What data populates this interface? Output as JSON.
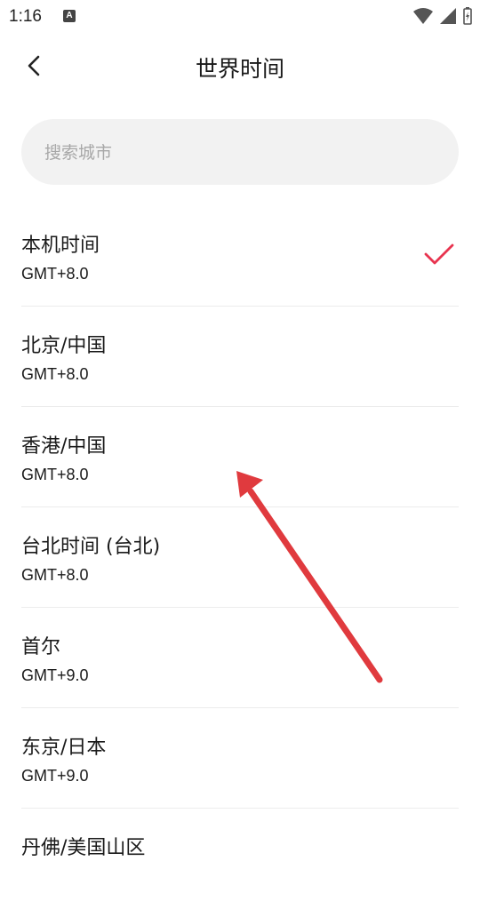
{
  "status_bar": {
    "time": "1:16",
    "notification_letter": "A"
  },
  "header": {
    "title": "世界时间",
    "back_icon": "chevron-left-icon"
  },
  "search": {
    "placeholder": "搜索城市",
    "value": ""
  },
  "cities": [
    {
      "name": "本机时间",
      "offset": "GMT+8.0",
      "selected": true
    },
    {
      "name": "北京/中国",
      "offset": "GMT+8.0",
      "selected": false
    },
    {
      "name": "香港/中国",
      "offset": "GMT+8.0",
      "selected": false
    },
    {
      "name": "台北时间 (台北)",
      "offset": "GMT+8.0",
      "selected": false
    },
    {
      "name": "首尔",
      "offset": "GMT+9.0",
      "selected": false
    },
    {
      "name": "东京/日本",
      "offset": "GMT+9.0",
      "selected": false
    },
    {
      "name": "丹佛/美国山区",
      "offset": "",
      "selected": false
    }
  ],
  "colors": {
    "accent_check": "#e8344f",
    "annotation_arrow": "#e03a3e"
  }
}
